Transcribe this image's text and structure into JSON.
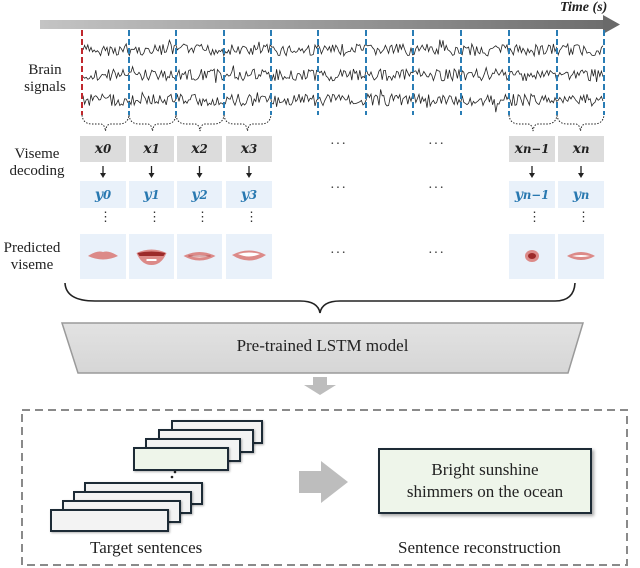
{
  "time_axis": {
    "label": "Time (s)"
  },
  "row_labels": {
    "brain": [
      "Brain",
      "signals"
    ],
    "viseme_decoding": [
      "Viseme",
      "decoding"
    ],
    "predicted": [
      "Predicted",
      "viseme"
    ]
  },
  "inputs": [
    {
      "base": "x",
      "sub": "0"
    },
    {
      "base": "x",
      "sub": "1"
    },
    {
      "base": "x",
      "sub": "2"
    },
    {
      "base": "x",
      "sub": "3"
    },
    {
      "base": "x",
      "sub": "n−1"
    },
    {
      "base": "x",
      "sub": "n"
    }
  ],
  "outputs": [
    {
      "base": "y",
      "sub": "0"
    },
    {
      "base": "y",
      "sub": "1"
    },
    {
      "base": "y",
      "sub": "2"
    },
    {
      "base": "y",
      "sub": "3"
    },
    {
      "base": "y",
      "sub": "n−1"
    },
    {
      "base": "y",
      "sub": "n"
    }
  ],
  "visemes": [
    "closed-lips",
    "open-lips-dark",
    "smile-teeth",
    "wide-teeth",
    "round-o",
    "spread-lips"
  ],
  "ellipsis": "···",
  "vertical_ellipsis": "⋮",
  "model": {
    "label": "Pre-trained LSTM model"
  },
  "bottom": {
    "target_caption": "Target sentences",
    "reconstruction_caption": "Sentence reconstruction",
    "sentence_lines": [
      "Bright sunshine",
      "shimmers on the ocean"
    ]
  },
  "colors": {
    "first_marker": "#c0282d",
    "segment_marker": "#2a7db5",
    "input_cell": "#dcdcdc",
    "output_cell": "#e9f1fa",
    "output_text": "#2878b0",
    "lip": "#dc8a88",
    "lip_dark": "#9c2a2a",
    "sentence_box": "#eef5ea",
    "arrow_gray": "#bdbdbd"
  }
}
